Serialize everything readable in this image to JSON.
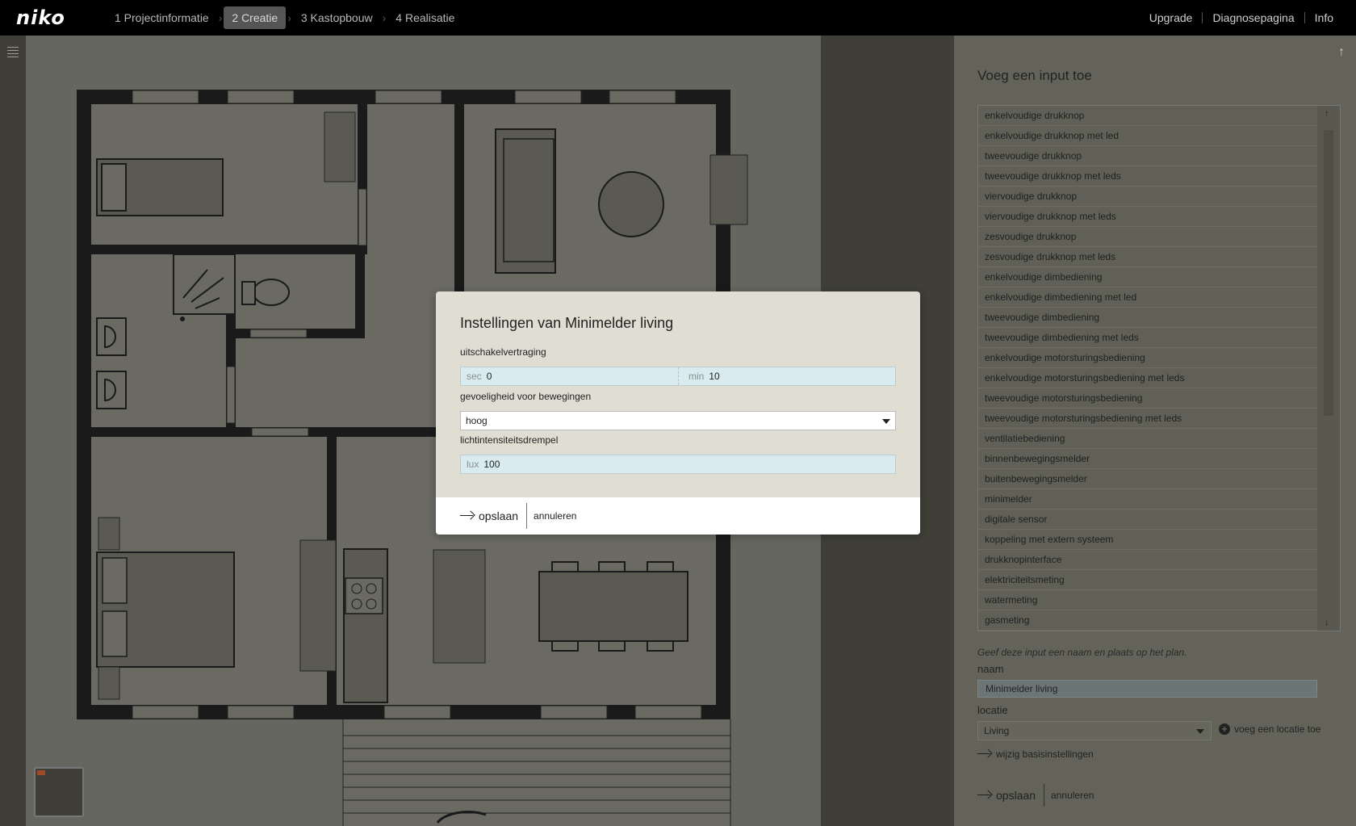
{
  "app": {
    "logo": "niko",
    "steps": [
      {
        "label": "1 Projectinformatie",
        "active": false
      },
      {
        "label": "2 Creatie",
        "active": true
      },
      {
        "label": "3 Kastopbouw",
        "active": false
      },
      {
        "label": "4 Realisatie",
        "active": false
      }
    ],
    "nav": {
      "upgrade": "Upgrade",
      "diagnose": "Diagnosepagina",
      "info": "Info"
    }
  },
  "panel": {
    "title": "Voeg een input toe",
    "items": [
      "enkelvoudige drukknop",
      "enkelvoudige drukknop met led",
      "tweevoudige drukknop",
      "tweevoudige drukknop met leds",
      "viervoudige drukknop",
      "viervoudige drukknop met leds",
      "zesvoudige drukknop",
      "zesvoudige drukknop met leds",
      "enkelvoudige dimbediening",
      "enkelvoudige dimbediening met led",
      "tweevoudige dimbediening",
      "tweevoudige dimbediening met leds",
      "enkelvoudige motorsturingsbediening",
      "enkelvoudige motorsturingsbediening met leds",
      "tweevoudige motorsturingsbediening",
      "tweevoudige motorsturingsbediening met leds",
      "ventilatiebediening",
      "binnenbewegingsmelder",
      "buitenbewegingsmelder",
      "minimelder",
      "digitale sensor",
      "koppeling met extern systeem",
      "drukknopinterface",
      "elektriciteitsmeting",
      "watermeting",
      "gasmeting"
    ],
    "hint": "Geef deze input een naam en plaats op het plan.",
    "name_label": "naam",
    "name_value": "Minimelder living",
    "location_label": "locatie",
    "location_value": "Living",
    "add_location": "voeg een locatie toe",
    "basic_settings": "wijzig basisinstellingen",
    "save": "opslaan",
    "cancel": "annuleren"
  },
  "modal": {
    "title": "Instellingen van Minimelder living",
    "delay_label": "uitschakelvertraging",
    "sec_unit": "sec",
    "sec_value": "0",
    "min_unit": "min",
    "min_value": "10",
    "sensitivity_label": "gevoeligheid voor bewegingen",
    "sensitivity_value": "hoog",
    "lux_label": "lichtintensiteitsdrempel",
    "lux_unit": "lux",
    "lux_value": "100",
    "save": "opslaan",
    "cancel": "annuleren"
  },
  "colors": {
    "topbar": "#000000",
    "modal_bg": "#e0ddd3",
    "input_bg": "#d9ebee",
    "panel_bg": "#636359"
  }
}
